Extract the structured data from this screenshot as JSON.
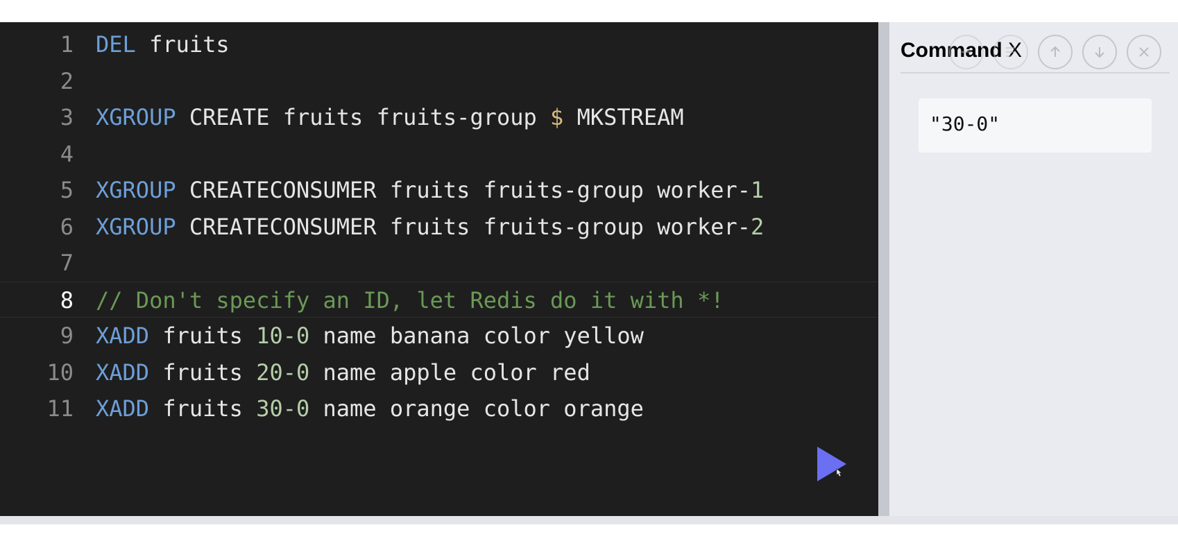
{
  "editor": {
    "lines": [
      {
        "number": "1",
        "tokens": [
          {
            "t": "DEL",
            "k": "kw"
          },
          {
            "t": " fruits",
            "k": "tx"
          }
        ]
      },
      {
        "number": "2",
        "tokens": []
      },
      {
        "number": "3",
        "tokens": [
          {
            "t": "XGROUP",
            "k": "kw"
          },
          {
            "t": " CREATE fruits fruits-group ",
            "k": "tx"
          },
          {
            "t": "$",
            "k": "sym"
          },
          {
            "t": " MKSTREAM",
            "k": "tx"
          }
        ]
      },
      {
        "number": "4",
        "tokens": []
      },
      {
        "number": "5",
        "tokens": [
          {
            "t": "XGROUP",
            "k": "kw"
          },
          {
            "t": " CREATECONSUMER fruits fruits-group worker-",
            "k": "tx"
          },
          {
            "t": "1",
            "k": "num"
          }
        ]
      },
      {
        "number": "6",
        "tokens": [
          {
            "t": "XGROUP",
            "k": "kw"
          },
          {
            "t": " CREATECONSUMER fruits fruits-group worker-",
            "k": "tx"
          },
          {
            "t": "2",
            "k": "num"
          }
        ]
      },
      {
        "number": "7",
        "tokens": []
      },
      {
        "number": "8",
        "active": true,
        "tokens": [
          {
            "t": "// Don't specify an ID, let Redis do it with *!",
            "k": "cm"
          }
        ]
      },
      {
        "number": "9",
        "tokens": [
          {
            "t": "XADD",
            "k": "kw"
          },
          {
            "t": " fruits ",
            "k": "tx"
          },
          {
            "t": "10-0",
            "k": "num"
          },
          {
            "t": " name banana color yellow",
            "k": "tx"
          }
        ]
      },
      {
        "number": "10",
        "tokens": [
          {
            "t": "XADD",
            "k": "kw"
          },
          {
            "t": " fruits ",
            "k": "tx"
          },
          {
            "t": "20-0",
            "k": "num"
          },
          {
            "t": " name apple color red",
            "k": "tx"
          }
        ]
      },
      {
        "number": "11",
        "tokens": [
          {
            "t": "XADD",
            "k": "kw"
          },
          {
            "t": " fruits ",
            "k": "tx"
          },
          {
            "t": "30-0",
            "k": "num"
          },
          {
            "t": " name orange color orange",
            "k": "tx"
          }
        ]
      }
    ],
    "run_icon": "play-icon"
  },
  "panel": {
    "title": "Command",
    "title_suffix": "X",
    "result": "\"30-0\"",
    "buttons": [
      {
        "name": "minimize-icon"
      },
      {
        "name": "format-icon"
      },
      {
        "name": "arrow-up-icon"
      },
      {
        "name": "arrow-down-icon"
      },
      {
        "name": "close-icon"
      }
    ]
  },
  "colors": {
    "editor_bg": "#1e1e1e",
    "keyword": "#6d9fd8",
    "number": "#b5cea8",
    "comment": "#6a9955",
    "run_button": "#6b6ff2",
    "panel_bg": "#e9ebf0"
  }
}
